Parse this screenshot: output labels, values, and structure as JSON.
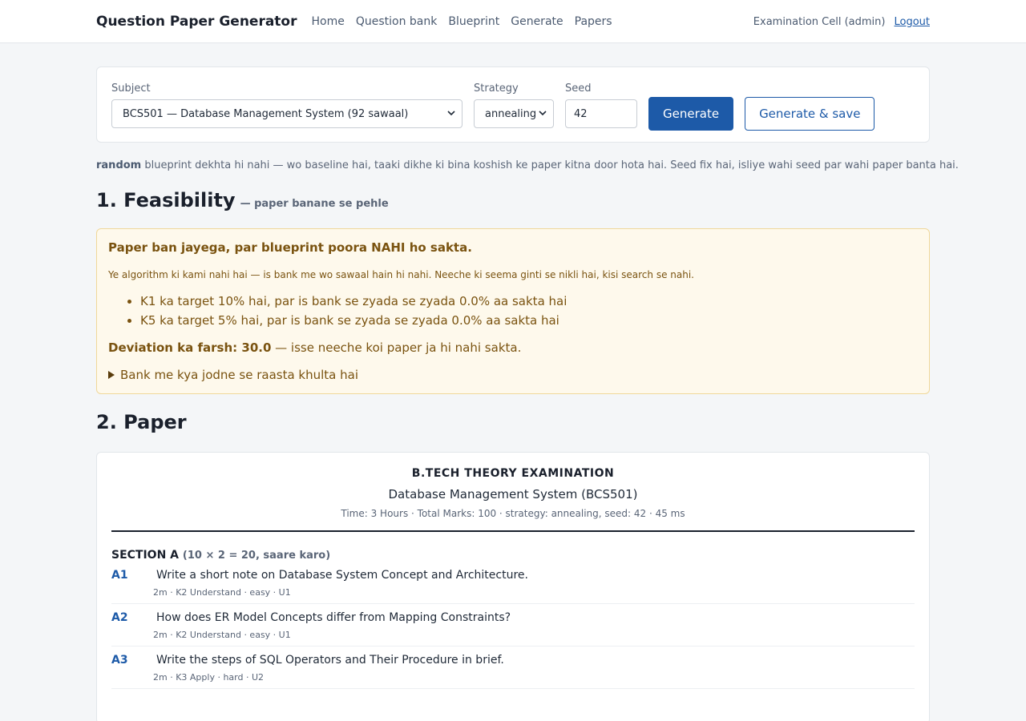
{
  "header": {
    "brand": "Question Paper Generator",
    "nav": [
      "Home",
      "Question bank",
      "Blueprint",
      "Generate",
      "Papers"
    ],
    "user": "Examination Cell (admin)",
    "logout": "Logout"
  },
  "form": {
    "subject_label": "Subject",
    "subject_value": "BCS501 — Database Management System (92 sawaal)",
    "strategy_label": "Strategy",
    "strategy_value": "annealing",
    "seed_label": "Seed",
    "seed_value": "42",
    "generate_label": "Generate",
    "generate_save_label": "Generate & save"
  },
  "note": {
    "bold": "random",
    "text": " blueprint dekhta hi nahi — wo baseline hai, taaki dikhe ki bina koshish ke paper kitna door hota hai. Seed fix hai, isliye wahi seed par wahi paper banta hai."
  },
  "feasibility": {
    "heading": "1. Feasibility",
    "subheading": "— paper banane se pehle",
    "title": "Paper ban jayega, par blueprint poora NAHI ho sakta.",
    "desc": "Ye algorithm ki kami nahi hai — is bank me wo sawaal hain hi nahi. Neeche ki seema ginti se nikli hai, kisi search se nahi.",
    "items": [
      "K1 ka target 10% hai, par is bank se zyada se zyada 0.0% aa sakta hai",
      "K5 ka target 5% hai, par is bank se zyada se zyada 0.0% aa sakta hai"
    ],
    "floor_bold": "Deviation ka farsh: 30.0",
    "floor_text": " — isse neeche koi paper ja hi nahi sakta.",
    "details": "Bank me kya jodne se raasta khulta hai"
  },
  "paper": {
    "heading": "2. Paper",
    "exam": "B.TECH THEORY EXAMINATION",
    "subject": "Database Management System (BCS501)",
    "meta": "Time: 3 Hours  ·  Total Marks: 100  ·  strategy: annealing, seed: 42  ·  45 ms",
    "section_title": "SECTION A",
    "section_rule": "(10 × 2 = 20, saare karo)",
    "questions": [
      {
        "id": "A1",
        "text": "Write a short note on Database System Concept and Architecture.",
        "meta": "2m · K2 Understand · easy · U1"
      },
      {
        "id": "A2",
        "text": "How does ER Model Concepts differ from Mapping Constraints?",
        "meta": "2m · K2 Understand · easy · U1"
      },
      {
        "id": "A3",
        "text": "Write the steps of SQL Operators and Their Procedure in brief.",
        "meta": "2m · K3 Apply · hard · U2"
      }
    ]
  }
}
